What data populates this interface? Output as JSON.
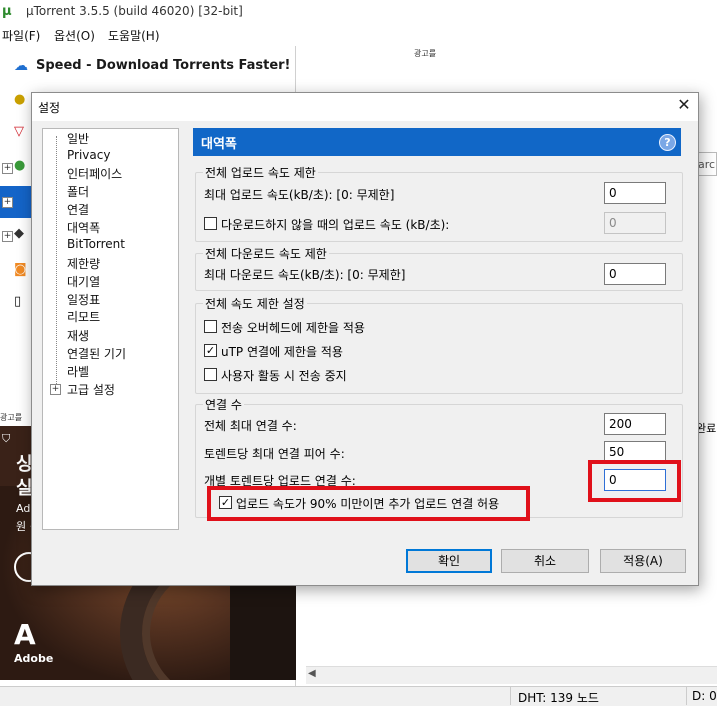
{
  "app": {
    "title": "µTorrent 3.5.5  (build 46020) [32-bit]",
    "logo_icon": "utorrent-logo-icon",
    "menu": [
      "파일(F)",
      "옵션(O)",
      "도움말(H)"
    ]
  },
  "sidebar": {
    "promo_label": "Speed - Download Torrents Faster!",
    "top_label": "광고를",
    "mid_label": "광고를",
    "search_fragment": "arch",
    "right_fragment": "완료"
  },
  "ad": {
    "line1": "싱",
    "line2": "실",
    "line3": "Ado",
    "line4": "원 ·",
    "brand_mark": "A",
    "brand": "Adobe"
  },
  "status": {
    "dht": "DHT: 139 노드",
    "download": "D: 0"
  },
  "dialog": {
    "title": "설정",
    "close_icon": "close-icon",
    "tree": [
      "일반",
      "Privacy",
      "인터페이스",
      "폴더",
      "연결",
      "대역폭",
      "BitTorrent",
      "제한량",
      "대기열",
      "일정표",
      "리모트",
      "재생",
      "연결된 기기",
      "라벨",
      "고급 설정"
    ],
    "section_title": "대역폭",
    "help_icon": "?",
    "upload_group": {
      "legend": "전체 업로드 속도 제한",
      "max_label": "최대 업로드 속도(kB/초): [0: 무제한]",
      "max_value": "0",
      "idle_label": "다운로드하지 않을 때의 업로드 속도 (kB/초):",
      "idle_checked": false,
      "idle_value": "0"
    },
    "download_group": {
      "legend": "전체 다운로드 속도 제한",
      "max_label": "최대 다운로드 속도(kB/초): [0: 무제한]",
      "max_value": "0"
    },
    "global_group": {
      "legend": "전체 속도 제한 설정",
      "overhead_label": "전송 오버헤드에 제한을 적용",
      "overhead_checked": false,
      "utp_label": "uTP 연결에 제한을 적용",
      "utp_checked": true,
      "activity_label": "사용자 활동 시 전송 중지",
      "activity_checked": false
    },
    "connections_group": {
      "legend": "연결 수",
      "global_max_label": "전체 최대 연결 수:",
      "global_max_value": "200",
      "peers_label": "토렌트당 최대 연결 피어 수:",
      "peers_value": "50",
      "upload_slots_label": "개별 토렌트당 업로드 연결 수:",
      "upload_slots_value": "0",
      "extra_slots_label": "업로드 속도가 90% 미만이면 추가 업로드 연결 허용",
      "extra_slots_checked": true
    },
    "buttons": {
      "ok": "확인",
      "cancel": "취소",
      "apply": "적용(A)"
    },
    "highlight_color": "#e0101a",
    "accent_color": "#1167c7"
  }
}
